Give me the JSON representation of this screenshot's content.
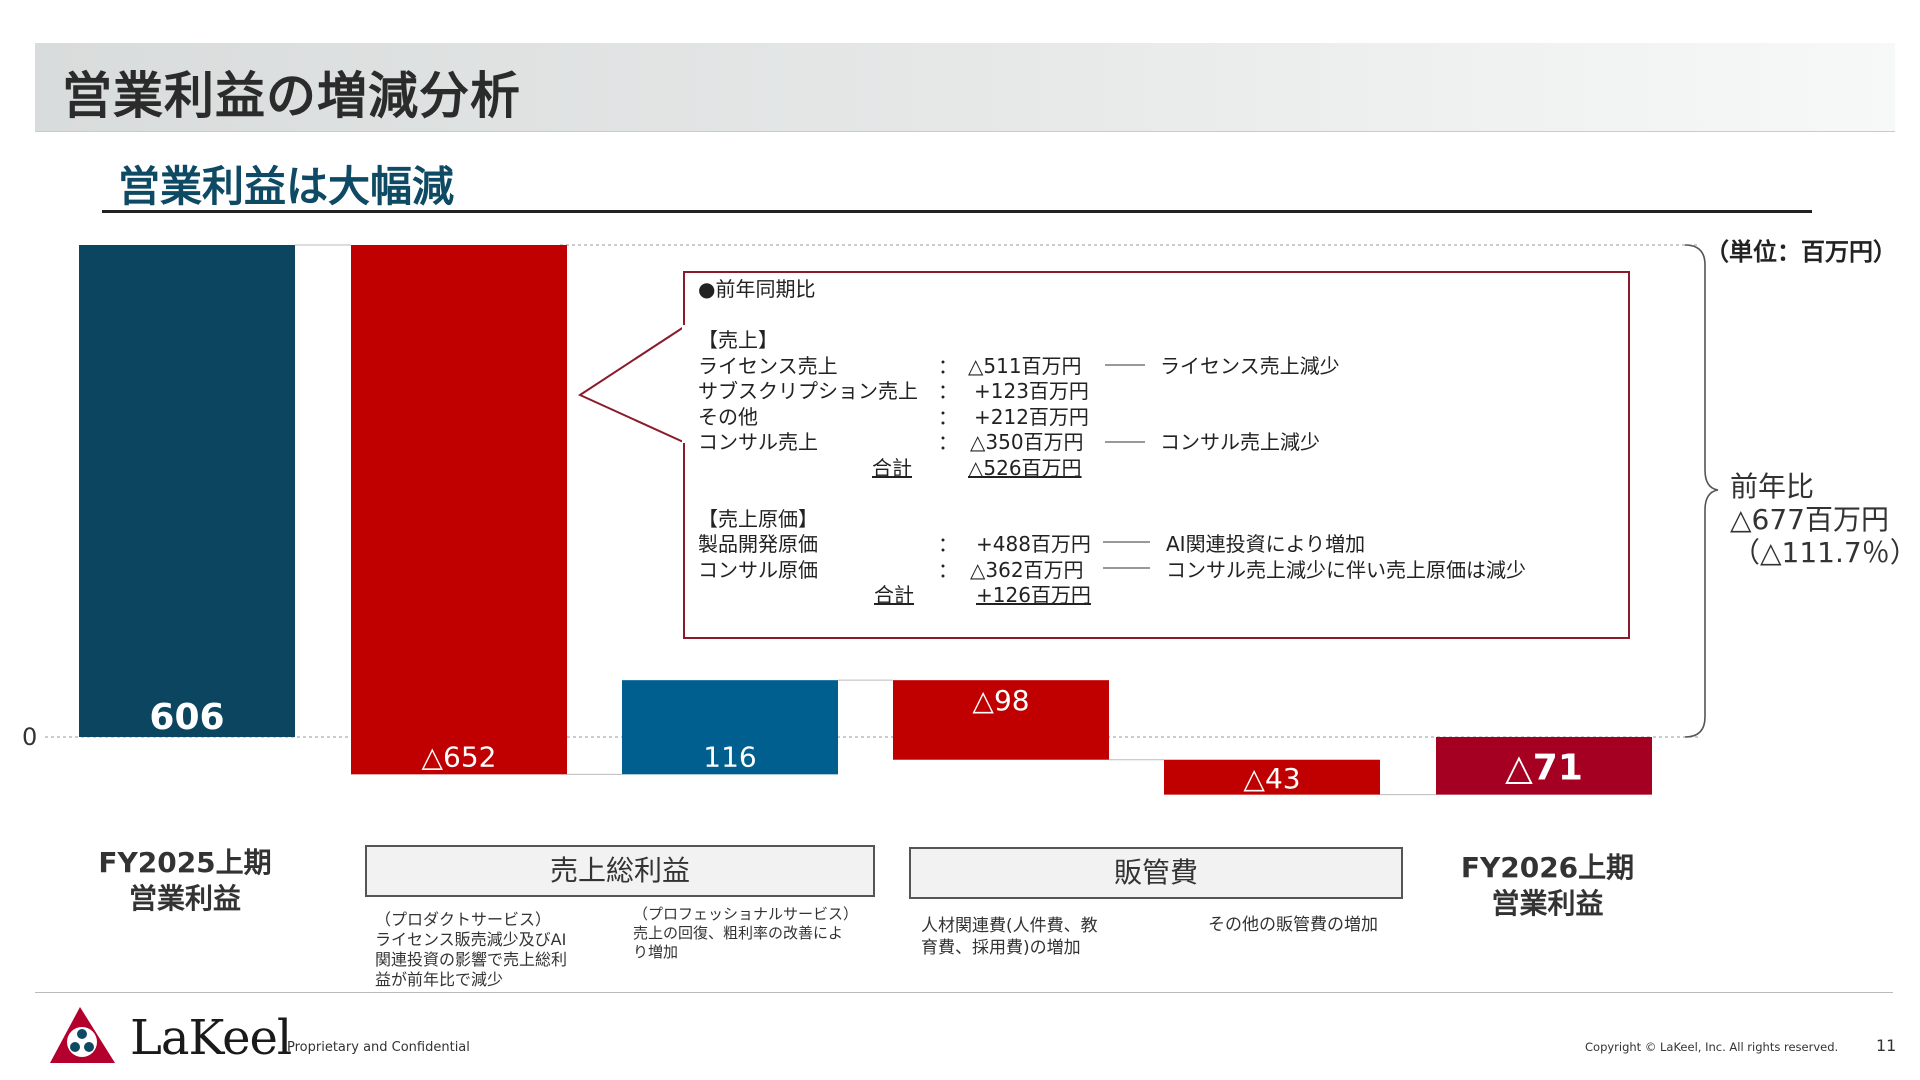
{
  "page": {
    "title": "営業利益の増減分析",
    "subtitle": "営業利益は大幅減",
    "unit": "（単位：百万円）"
  },
  "chart_data": {
    "type": "waterfall",
    "zero_label": "0",
    "bars": [
      {
        "value": 606,
        "label": "606",
        "base": 0,
        "kind": "total",
        "color": "#0b4560"
      },
      {
        "value": -652,
        "label": "△652",
        "base": 606,
        "kind": "decrease",
        "color": "#c00000"
      },
      {
        "value": 116,
        "label": "116",
        "base": -46,
        "kind": "increase",
        "color": "#005f8f"
      },
      {
        "value": -98,
        "label": "△98",
        "base": 70,
        "kind": "decrease",
        "color": "#c00000"
      },
      {
        "value": -43,
        "label": "△43",
        "base": -28,
        "kind": "decrease",
        "color": "#c00000"
      },
      {
        "value": -71,
        "label": "△71",
        "base": 0,
        "kind": "total",
        "color": "#a50021"
      }
    ],
    "start_category": {
      "line1": "FY2025上期",
      "line2": "営業利益"
    },
    "end_category": {
      "line1": "FY2026上期",
      "line2": "営業利益"
    },
    "group_labels": [
      "売上総利益",
      "販管費"
    ],
    "notes": [
      "（プロダクトサービス）\nライセンス販売減少及びAI\n関連投資の影響で売上総利\n益が前年比で減少",
      "（プロフェッショナルサービス）\n売上の回復、粗利率の改善によ\nり増加",
      "人材関連費(人件費、教\n育費、採用費)の増加",
      "その他の販管費の増加"
    ],
    "summary": {
      "line1": "前年比",
      "line2": "△677百万円",
      "line3": "（△111.7％）"
    },
    "callout": {
      "heading": "●前年同期比",
      "sales_header": "【売上】",
      "sales_rows": [
        {
          "item": "ライセンス売上",
          "colon": "：",
          "value": "△511百万円",
          "comment": "ライセンス売上減少"
        },
        {
          "item": "サブスクリプション売上",
          "colon": "：",
          "value": "+123百万円",
          "comment": ""
        },
        {
          "item": "その他",
          "colon": "：",
          "value": "+212百万円",
          "comment": ""
        },
        {
          "item": "コンサル売上",
          "colon": "：",
          "value": "△350百万円",
          "comment": "コンサル売上減少"
        }
      ],
      "sales_total_label": "合計",
      "sales_total_value": "△526百万円",
      "cost_header": "【売上原価】",
      "cost_rows": [
        {
          "item": "製品開発原価",
          "colon": "：",
          "value": "+488百万円",
          "comment": "AI関連投資により増加"
        },
        {
          "item": "コンサル原価",
          "colon": "：",
          "value": "△362百万円",
          "comment": "コンサル売上減少に伴い売上原価は減少"
        }
      ],
      "cost_total_label": "合計",
      "cost_total_value": "+126百万円"
    }
  },
  "footer": {
    "logo": "LaKeel",
    "tagline": "Proprietary and Confidential",
    "copyright": "Copyright © LaKeel, Inc.  All rights reserved.",
    "page_number": "11"
  }
}
